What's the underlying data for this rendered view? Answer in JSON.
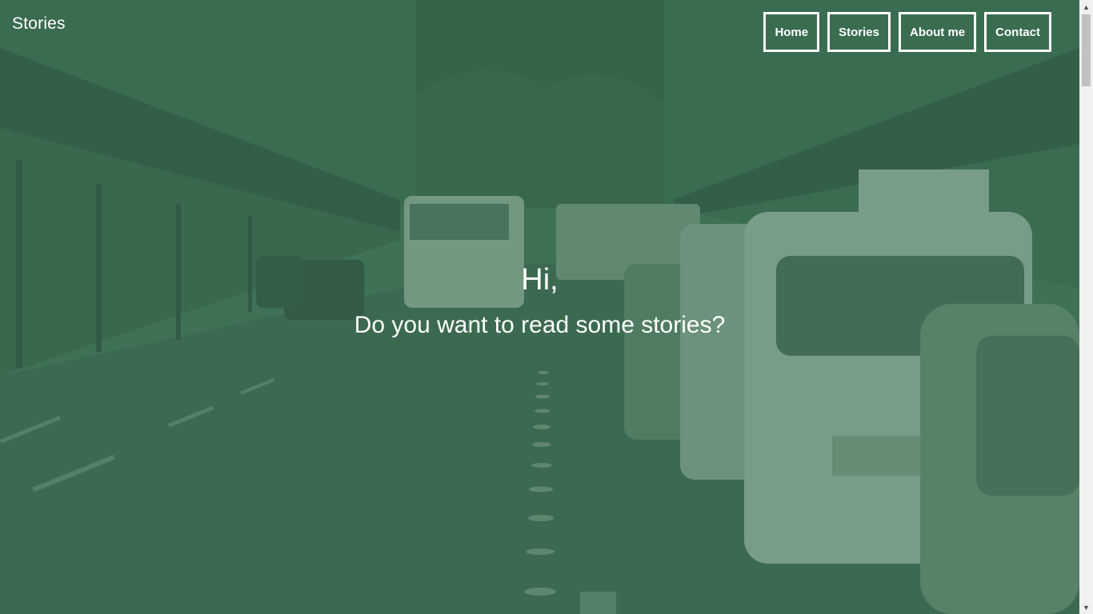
{
  "header": {
    "brand": "Stories"
  },
  "nav": {
    "items": [
      {
        "label": "Home",
        "name": "nav-home"
      },
      {
        "label": "Stories",
        "name": "nav-stories"
      },
      {
        "label": "About me",
        "name": "nav-about-me"
      },
      {
        "label": "Contact",
        "name": "nav-contact"
      }
    ]
  },
  "hero": {
    "greeting": "Hi,",
    "subtitle": "Do you want to read some stories?"
  },
  "theme": {
    "overlay_color": "#3a6e50",
    "text_color": "#ffffff"
  },
  "icons": {
    "scroll_up": "scroll-up-arrow-icon",
    "scroll_down": "scroll-down-arrow-icon"
  }
}
